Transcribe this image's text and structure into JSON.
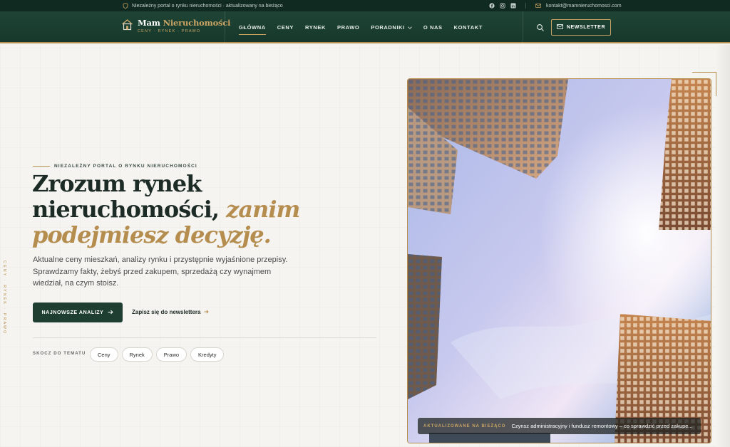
{
  "topbar": {
    "tagline": "Niezależny portal o rynku nieruchomości · aktualizowany na bieżąco",
    "email": "kontakt@mamnieruchomosci.com",
    "socials": [
      "facebook-icon",
      "instagram-icon",
      "linkedin-icon"
    ]
  },
  "nav": {
    "logo_main": "Mam ",
    "logo_accent": "Nieruchomości",
    "logo_sub": "CENY · RYNEK · PRAWO",
    "items": [
      {
        "label": "GŁÓWNA",
        "active": true
      },
      {
        "label": "CENY"
      },
      {
        "label": "RYNEK"
      },
      {
        "label": "PRAWO"
      },
      {
        "label": "PORADNIKI"
      },
      {
        "label": "O NAS"
      },
      {
        "label": "KONTAKT"
      }
    ],
    "newsletter": "NEWSLETTER"
  },
  "hero": {
    "eyebrow": "NIEZALEŻNY PORTAL O RYNKU NIERUCHOMOŚCI",
    "title_line1": "Zrozum rynek",
    "title_line2": "nieruchomości, ",
    "title_italic_a": "zanim",
    "title_italic_b": "podejmiesz decyzję.",
    "lead": "Aktualne ceny mieszkań, analizy rynku i przystępnie wyjaśnione przepisy. Sprawdzamy fakty, żebyś przed zakupem, sprzedażą czy wynajmem wiedział, na czym stoisz.",
    "cta_primary": "NAJNOWSZE ANALIZY",
    "cta_secondary": "Zapisz się do newslettera",
    "jump_label": "SKOCZ DO TEMATU",
    "chips": [
      "Ceny",
      "Rynek",
      "Prawo",
      "Kredyty"
    ],
    "side_label": "CENY · RYNEK · PRAWO"
  },
  "feature": {
    "badge": "AKTUALIZOWANE NA BIEŻĄCO",
    "caption": "Czynsz administracyjny i fundusz remontowy – co sprawdzić przed zakupe..."
  },
  "colors": {
    "brand_dark": "#1d3e31",
    "accent_gold": "#b58d4e"
  }
}
